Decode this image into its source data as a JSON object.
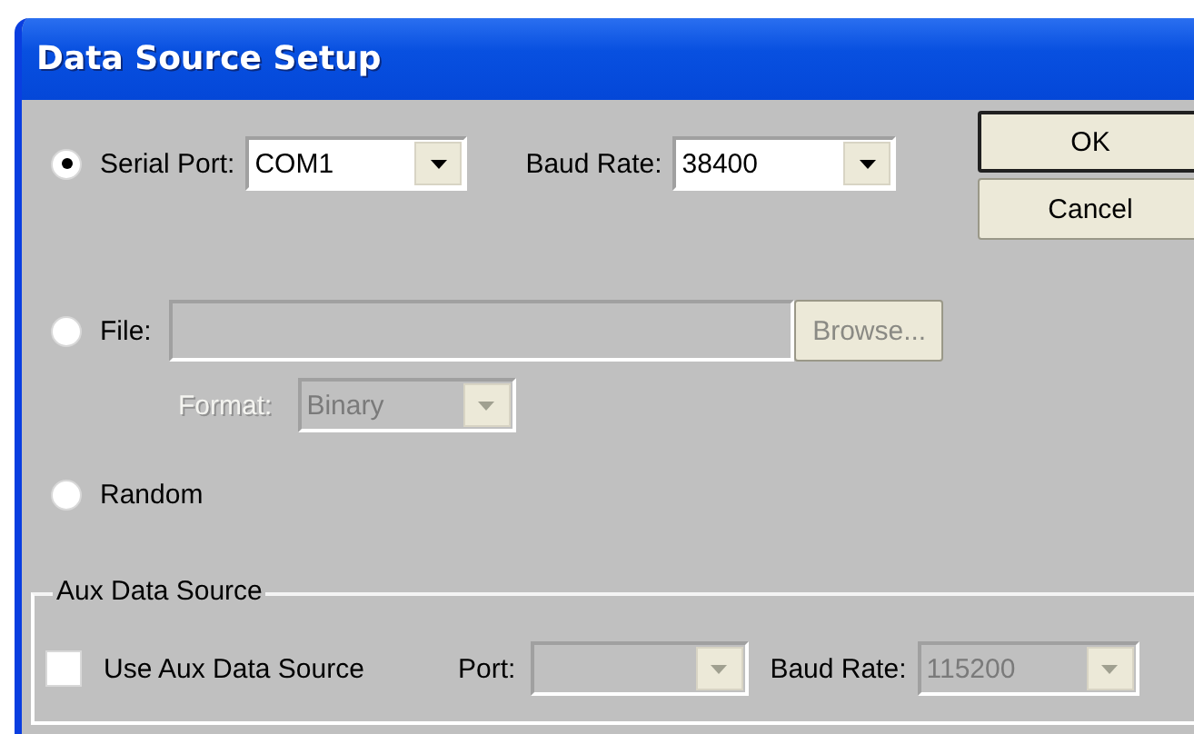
{
  "window": {
    "title": "Data Source Setup"
  },
  "sources": [
    {
      "kind": "serial",
      "label": "Serial Port:",
      "selected": true,
      "port": {
        "value": "COM1",
        "disabled": false
      },
      "baud_label": "Baud Rate:",
      "baud": {
        "value": "38400",
        "disabled": false
      }
    },
    {
      "kind": "file",
      "label": "File:",
      "selected": false,
      "path": {
        "disabled": true
      },
      "browse": {
        "label": "Browse...",
        "disabled": true
      },
      "format_label": "Format:",
      "format": {
        "value": "Binary",
        "disabled": true
      }
    },
    {
      "kind": "random",
      "label": "Random",
      "selected": false
    }
  ],
  "buttons": [
    {
      "label": "OK",
      "default": true
    },
    {
      "label": "Cancel",
      "default": false
    }
  ],
  "aux": {
    "title": "Aux Data Source",
    "use": {
      "label": "Use Aux Data Source",
      "checked": false
    },
    "port_label": "Port:",
    "port": {
      "disabled": true
    },
    "baud_label": "Baud Rate:",
    "baud": {
      "value": "115200",
      "disabled": true
    }
  }
}
